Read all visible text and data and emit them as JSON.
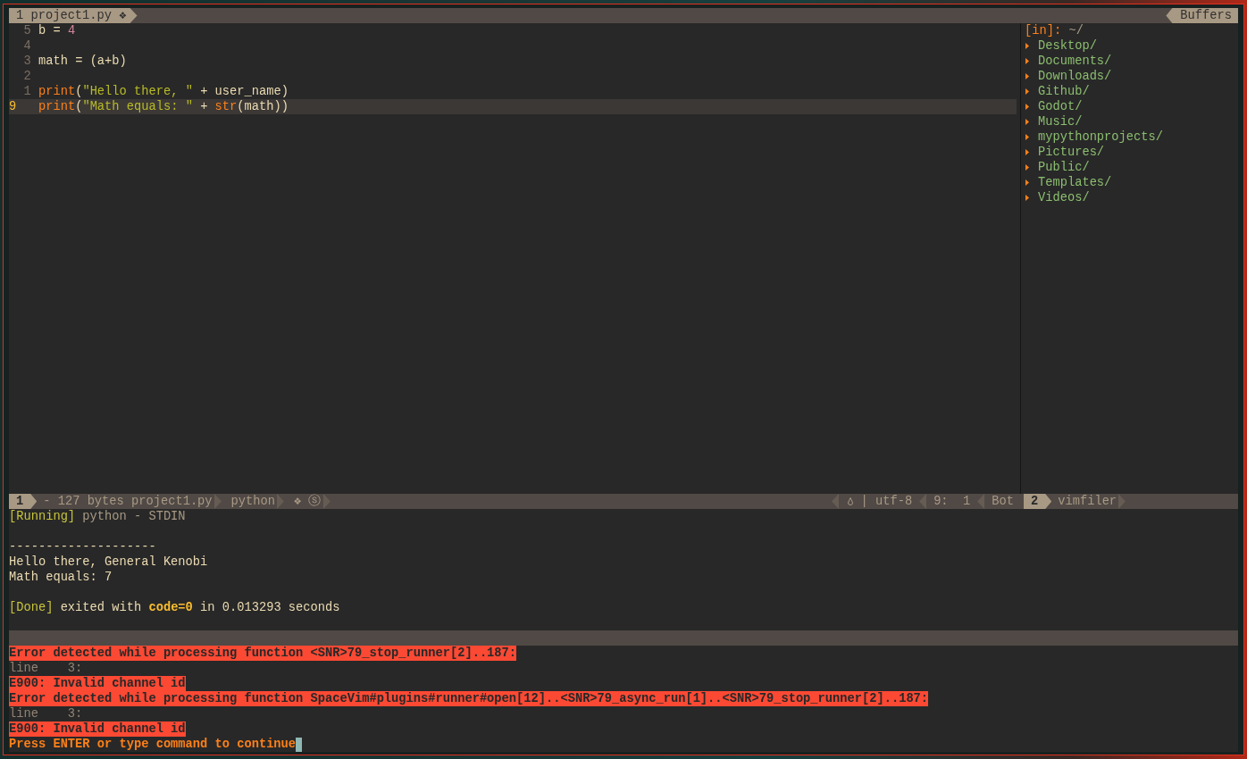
{
  "tabline": {
    "tabs": [
      {
        "number": "1",
        "label": "project1.py",
        "flag": "❖",
        "selected": true
      }
    ],
    "buffers_label": "Buffers"
  },
  "editor": {
    "lines": [
      {
        "number": "5",
        "current": false,
        "tokens": [
          {
            "kind": "plain",
            "text": "b = "
          },
          {
            "kind": "number",
            "text": "4"
          }
        ]
      },
      {
        "number": "4",
        "current": false
      },
      {
        "number": "3",
        "current": false,
        "tokens": [
          {
            "kind": "plain",
            "text": "math = (a+b)"
          }
        ]
      },
      {
        "number": "2",
        "current": false
      },
      {
        "number": "1",
        "current": false,
        "tokens": [
          {
            "kind": "function",
            "text": "print"
          },
          {
            "kind": "plain",
            "text": "("
          },
          {
            "kind": "string",
            "text": "\"Hello there, \""
          },
          {
            "kind": "plain",
            "text": " + user_name)"
          }
        ]
      },
      {
        "number": "9",
        "current": true,
        "tokens": [
          {
            "kind": "function",
            "text": "print"
          },
          {
            "kind": "plain",
            "text": "("
          },
          {
            "kind": "string",
            "text": "\"Math equals: \""
          },
          {
            "kind": "plain",
            "text": " + "
          },
          {
            "kind": "function",
            "text": "str"
          },
          {
            "kind": "plain",
            "text": "(math))"
          }
        ]
      }
    ]
  },
  "file_tree": {
    "mode_label": "[in]:",
    "path": "~/",
    "items": [
      {
        "name": "Desktop/",
        "expanded": false
      },
      {
        "name": "Documents/",
        "expanded": false
      },
      {
        "name": "Downloads/",
        "expanded": false
      },
      {
        "name": "Github/",
        "expanded": false
      },
      {
        "name": "Godot/",
        "expanded": false
      },
      {
        "name": "Music/",
        "expanded": false
      },
      {
        "name": "mypythonprojects/",
        "expanded": false
      },
      {
        "name": "Pictures/",
        "expanded": false
      },
      {
        "name": "Public/",
        "expanded": false
      },
      {
        "name": "Templates/",
        "expanded": false
      },
      {
        "name": "Videos/",
        "expanded": false
      }
    ]
  },
  "status_bar": {
    "left": [
      {
        "kind": "number",
        "text": "1"
      },
      {
        "kind": "text",
        "text": "- 127 bytes project1.py"
      },
      {
        "kind": "text",
        "text": "python"
      },
      {
        "kind": "text",
        "text": "❖ ⓢ"
      }
    ],
    "right": [
      {
        "kind": "fileformat",
        "text": "| utf-8"
      },
      {
        "kind": "text",
        "text": "9:  1"
      },
      {
        "kind": "text",
        "text": "Bot"
      }
    ],
    "tree": [
      {
        "kind": "number",
        "text": "2"
      },
      {
        "kind": "text",
        "text": "vimfiler"
      }
    ]
  },
  "runner": {
    "lines": [
      {
        "kind": "text",
        "tokens": [
          {
            "kind": "tag",
            "text": "[Running]"
          },
          {
            "kind": "dim",
            "text": " python - STDIN"
          }
        ]
      },
      {
        "kind": "blank"
      },
      {
        "kind": "text",
        "tokens": [
          {
            "kind": "plain",
            "text": "--------------------"
          }
        ]
      },
      {
        "kind": "text",
        "tokens": [
          {
            "kind": "plain",
            "text": "Hello there, General Kenobi"
          }
        ]
      },
      {
        "kind": "text",
        "tokens": [
          {
            "kind": "plain",
            "text": "Math equals: 7"
          }
        ]
      },
      {
        "kind": "blank"
      },
      {
        "kind": "text",
        "tokens": [
          {
            "kind": "tag",
            "text": "[Done]"
          },
          {
            "kind": "plain",
            "text": " exited with "
          },
          {
            "kind": "emphasis",
            "text": "code=0"
          },
          {
            "kind": "plain",
            "text": " in 0.013293 seconds"
          }
        ]
      }
    ]
  },
  "messages": [
    {
      "kind": "error",
      "text": "Error detected while processing function <SNR>79_stop_runner[2]..187:"
    },
    {
      "kind": "detail",
      "text": "line    3:"
    },
    {
      "kind": "error",
      "text": "E900: Invalid channel id"
    },
    {
      "kind": "error",
      "text": "Error detected while processing function SpaceVim#plugins#runner#open[12]..<SNR>79_async_run[1]..<SNR>79_stop_runner[2]..187:"
    },
    {
      "kind": "detail",
      "text": "line    3:"
    },
    {
      "kind": "error",
      "text": "E900: Invalid channel id"
    },
    {
      "kind": "prompt",
      "text": "Press ENTER or type command to continue",
      "cursor": true
    }
  ]
}
